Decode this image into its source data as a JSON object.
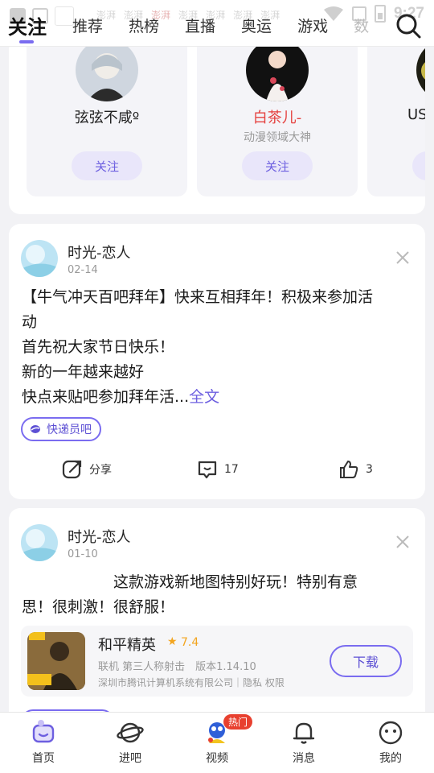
{
  "status_bar": {
    "time": "9:27",
    "ghost_icons": [
      "澎湃",
      "澎湃",
      "澎湃",
      "澎湃",
      "澎湃",
      "澎湃",
      "澎湃"
    ]
  },
  "tabs": [
    "关注",
    "推荐",
    "热榜",
    "直播",
    "奥运",
    "游戏",
    "数"
  ],
  "recommend": [
    {
      "name": "弦弦不咸º",
      "subtitle": "",
      "button": "关注"
    },
    {
      "name": "白茶儿-",
      "subtitle": "动漫领域大神",
      "button": "关注"
    },
    {
      "name": "US",
      "subtitle": "",
      "button": ""
    }
  ],
  "posts": [
    {
      "author": "时光-恋人",
      "date": "02-14",
      "lines": [
        "【牛气冲天百吧拜年】快来互相拜年！积极来参加活",
        "动",
        "首先祝大家节日快乐！",
        "新的一年越来越好"
      ],
      "last_line": "快点来贴吧参加拜年活...",
      "full_text_link": "全文",
      "tag": "快递员吧",
      "actions": {
        "share": "分享",
        "comments": "17",
        "likes": "3"
      }
    },
    {
      "author": "时光-恋人",
      "date": "01-10",
      "lines": [
        "　　　　　　这款游戏新地图特别好玩！特别有意",
        "思！很刺激！很舒服！"
      ],
      "game": {
        "name": "和平精英",
        "rating": "7.4",
        "meta": "联机 第三人称射击　版本1.14.10",
        "company": "深圳市腾讯计算机系统有限公司｜隐私 权限",
        "button": "下载"
      }
    }
  ],
  "bottom_nav": [
    {
      "label": "首页"
    },
    {
      "label": "进吧"
    },
    {
      "label": "视频",
      "badge": "热门"
    },
    {
      "label": "消息"
    },
    {
      "label": "我的"
    }
  ],
  "colors": {
    "accent": "#7a6cf0",
    "red_name": "#e5413f",
    "hot_badge": "#e8402f",
    "star": "#f3a51f"
  }
}
